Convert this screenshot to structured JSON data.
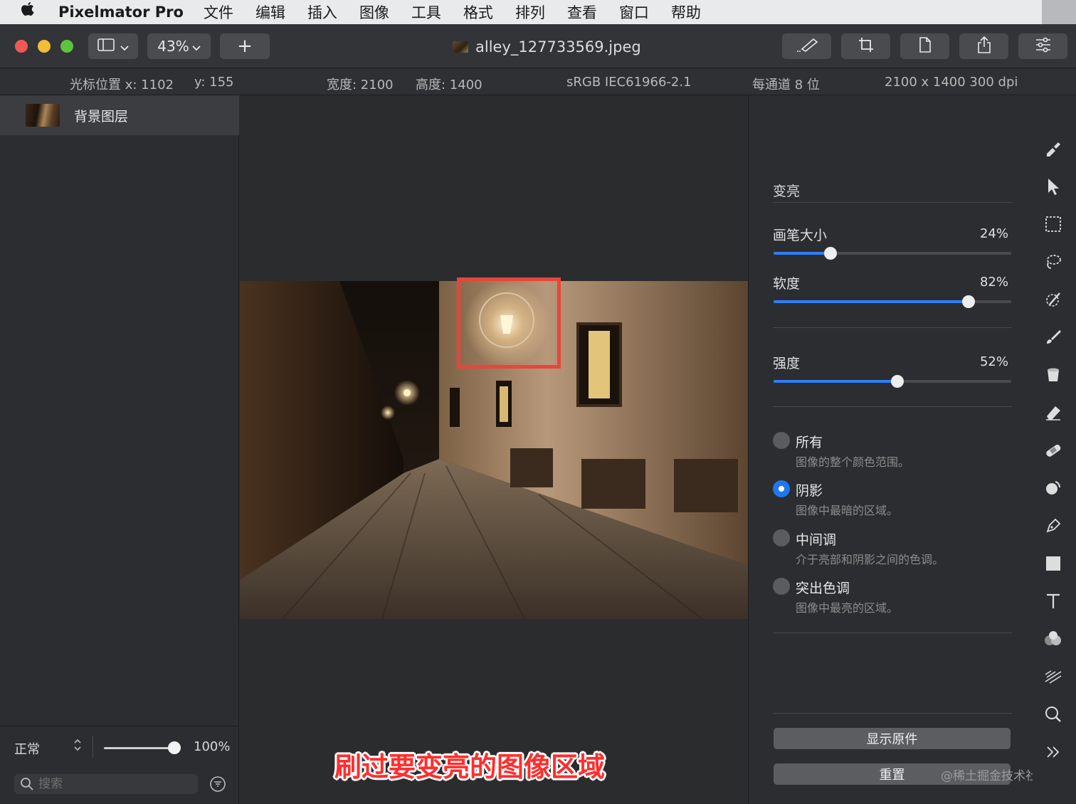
{
  "menubar": {
    "app_name": "Pixelmator Pro",
    "menus": [
      "文件",
      "编辑",
      "插入",
      "图像",
      "工具",
      "格式",
      "排列",
      "查看",
      "窗口",
      "帮助"
    ]
  },
  "toolbar": {
    "zoom": "43%",
    "add_label": "+",
    "doc_title": "alley_127733569.jpeg"
  },
  "infobar": {
    "cursor_x": "光标位置 x:  1102",
    "cursor_y": "y:  155",
    "width": "宽度:  2100",
    "height": "高度:  1400",
    "color_profile": "sRGB IEC61966-2.1",
    "bit_depth": "每通道 8 位",
    "dimensions": "2100 x 1400 300 dpi"
  },
  "layers": {
    "items": [
      {
        "name": "背景图层"
      }
    ],
    "blend_mode": "正常",
    "opacity": "100%",
    "opacity_fraction": 1.0,
    "search_placeholder": "搜索"
  },
  "canvas": {
    "caption": "刷过要变亮的图像区域"
  },
  "adjust": {
    "title": "变亮",
    "sliders": [
      {
        "label": "画笔大小",
        "value": "24%",
        "fraction": 0.24
      },
      {
        "label": "软度",
        "value": "82%",
        "fraction": 0.82
      },
      {
        "label": "强度",
        "value": "52%",
        "fraction": 0.52
      }
    ],
    "ranges": [
      {
        "label": "所有",
        "desc": "图像的整个颜色范围。",
        "selected": false
      },
      {
        "label": "阴影",
        "desc": "图像中最暗的区域。",
        "selected": true
      },
      {
        "label": "中间调",
        "desc": "介于亮部和阴影之间的色调。",
        "selected": false
      },
      {
        "label": "突出色调",
        "desc": "图像中最亮的区域。",
        "selected": false
      }
    ],
    "show_original": "显示原件",
    "reset": "重置",
    "watermark": "@稀土掘金技术社区"
  },
  "colors": {
    "accent": "#1f78f0",
    "highlight_box": "#e8453c",
    "caption": "#ff2e2e"
  },
  "tools": [
    "paint-style-icon",
    "arrow-select-icon",
    "rect-select-icon",
    "lasso-icon",
    "magic-wand-icon",
    "brush-icon",
    "bucket-icon",
    "eraser-icon",
    "bandage-icon",
    "clone-icon",
    "pen-icon",
    "shape-icon",
    "text-icon",
    "color-adjust-icon",
    "distort-icon",
    "zoom-icon",
    "more-tools-icon"
  ]
}
